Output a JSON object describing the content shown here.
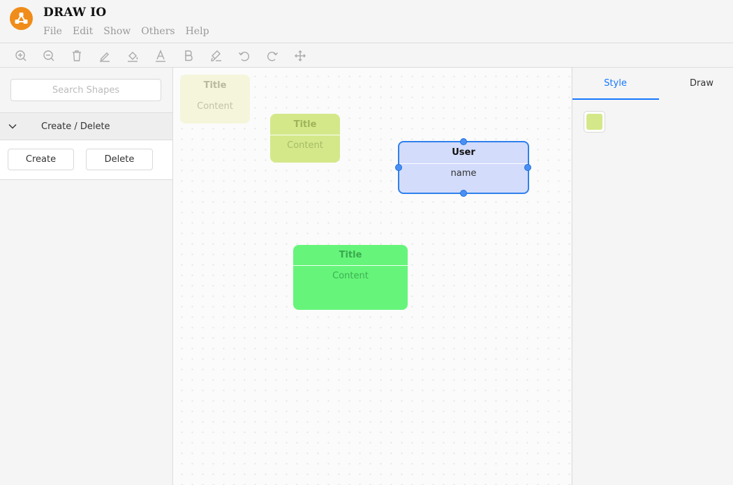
{
  "app": {
    "title": "DRAW IO",
    "menu": [
      "File",
      "Edit",
      "Show",
      "Others",
      "Help"
    ]
  },
  "toolbar": {
    "tools": [
      "zoom-in-icon",
      "zoom-out-icon",
      "trash-icon",
      "pen-icon",
      "fill-icon",
      "font-color-icon",
      "bold-icon",
      "highlighter-icon",
      "undo-icon",
      "redo-icon",
      "move-icon"
    ]
  },
  "sidebar": {
    "search_placeholder": "Search Shapes",
    "section_title": "Create / Delete",
    "create_label": "Create",
    "delete_label": "Delete"
  },
  "canvas": {
    "nodes": [
      {
        "title": "Title",
        "content": "Content",
        "color": "#f5f5dc"
      },
      {
        "title": "Title",
        "content": "Content",
        "color": "#d4e88a"
      },
      {
        "title": "User",
        "content": "name",
        "color": "#d3dcfb",
        "selected": true
      },
      {
        "title": "Title",
        "content": "Content",
        "color": "#66f57a"
      }
    ]
  },
  "right_panel": {
    "tabs": [
      "Style",
      "Draw"
    ],
    "active_tab": "Style",
    "swatch_color": "#d4e88a"
  },
  "colors": {
    "accent": "#1677ff",
    "logo": "#f08c1a",
    "selection": "#2f80ed"
  }
}
